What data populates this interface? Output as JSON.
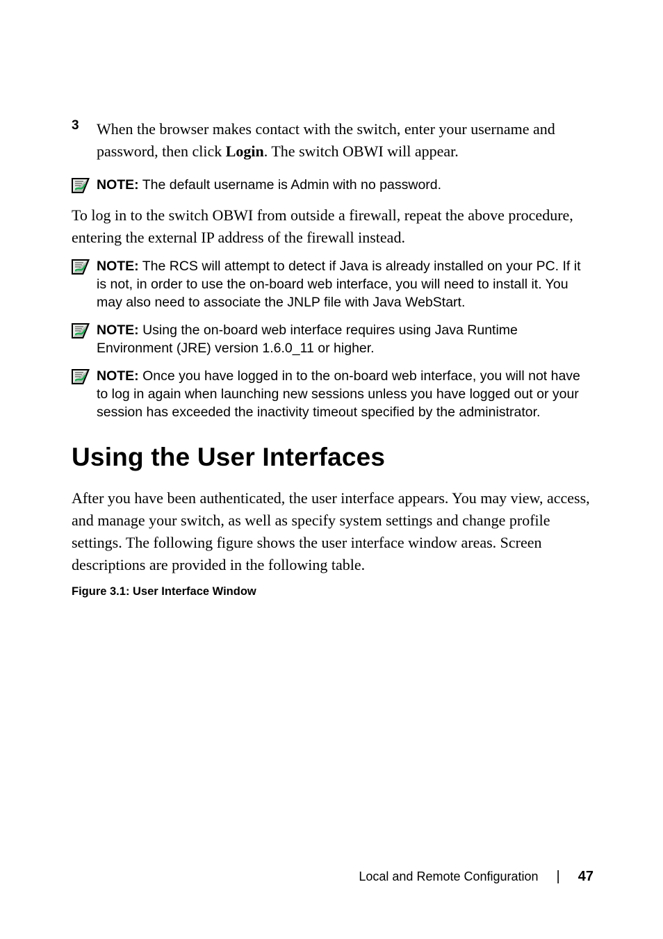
{
  "step": {
    "number": "3",
    "text_before_bold": "When the browser makes contact with the switch, enter your username and password, then click ",
    "bold_word": "Login",
    "text_after_bold": ". The switch OBWI will appear."
  },
  "notes": {
    "n1_label": "NOTE:",
    "n1_text": " The default username is Admin with no password.",
    "n2_label": "NOTE:",
    "n2_text": " The RCS will attempt to detect if Java is already installed on your PC. If it is not, in order to use the on-board web interface, you will need to install it. You may also need to associate the JNLP file with Java WebStart.",
    "n3_label": "NOTE:",
    "n3_text": " Using the on-board web interface requires using Java Runtime Environment (JRE) version 1.6.0_11 or higher.",
    "n4_label": "NOTE:",
    "n4_text": " Once you have logged in to the on-board web interface, you will not have to log in again when launching new sessions unless you have logged out or your session has exceeded the inactivity timeout specified by the administrator."
  },
  "para1": "To log in to the switch OBWI from outside a firewall, repeat the above procedure, entering the external IP address of the firewall instead.",
  "heading": "Using the User Interfaces",
  "para2": "After you have been authenticated, the user interface appears. You may view, access, and manage your switch, as well as specify system settings and change profile settings. The following figure shows the user interface window areas. Screen descriptions are provided in the following table.",
  "fig_caption": "Figure 3.1: User Interface Window",
  "footer": {
    "section": "Local and Remote Configuration",
    "page": "47"
  }
}
